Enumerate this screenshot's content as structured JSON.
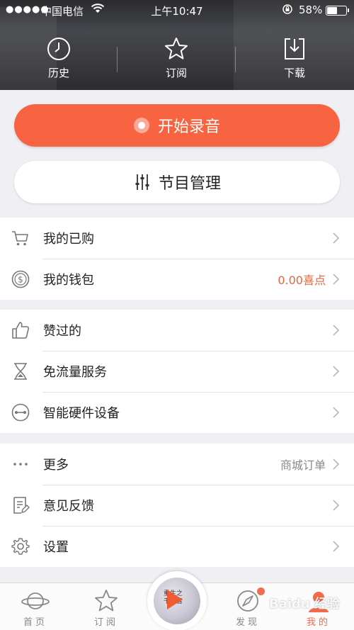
{
  "status_bar": {
    "signal": "●●●●●",
    "carrier": "中国电信",
    "time": "上午10:47",
    "battery_pct": "58%",
    "battery_level": 0.58
  },
  "top_nav": [
    {
      "label": "历史",
      "icon": "clock-icon"
    },
    {
      "label": "订阅",
      "icon": "star-icon"
    },
    {
      "label": "下载",
      "icon": "download-icon"
    }
  ],
  "actions": {
    "record_label": "开始录音",
    "manage_label": "节目管理"
  },
  "menu_group_1": [
    {
      "label": "我的已购",
      "icon": "cart-icon",
      "value": ""
    },
    {
      "label": "我的钱包",
      "icon": "coin-icon",
      "value": "0.00喜点"
    }
  ],
  "menu_group_2": [
    {
      "label": "赞过的",
      "icon": "thumbs-up-icon",
      "value": ""
    },
    {
      "label": "免流量服务",
      "icon": "hourglass-icon",
      "value": ""
    },
    {
      "label": "智能硬件设备",
      "icon": "device-icon",
      "value": ""
    }
  ],
  "menu_group_3": [
    {
      "label": "更多",
      "icon": "more-dots-icon",
      "value": "商城订单"
    },
    {
      "label": "意见反馈",
      "icon": "feedback-icon",
      "value": ""
    },
    {
      "label": "设置",
      "icon": "gear-icon",
      "value": ""
    }
  ],
  "tab_bar": [
    {
      "label": "首页",
      "icon": "planet-icon"
    },
    {
      "label": "订阅",
      "icon": "star-icon"
    },
    {
      "label": "发现",
      "icon": "compass-icon"
    },
    {
      "label": "我的",
      "icon": "user-icon"
    }
  ],
  "now_playing_cover_text": "重生之\n千般音",
  "watermark": "Baidu 经验",
  "colors": {
    "accent": "#f86442",
    "value_accent": "#e0663d",
    "tab_active": "#f26b4a",
    "header": "#3a3a3e"
  }
}
